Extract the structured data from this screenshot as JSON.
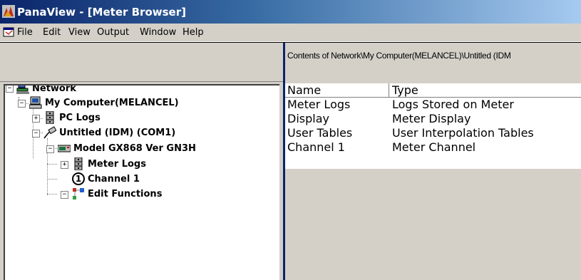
{
  "window": {
    "title": "PanaView - [Meter Browser]",
    "app_icon": "panaview-app-icon"
  },
  "menu": {
    "items": [
      "File",
      "Edit",
      "View",
      "Output",
      "Window",
      "Help"
    ]
  },
  "content_caption": "Contents of Network\\My Computer(MELANCEL)\\Untitled (IDM",
  "list": {
    "columns": [
      "Name",
      "Type"
    ],
    "rows": [
      {
        "name": "Meter Logs",
        "type": "Logs Stored on Meter"
      },
      {
        "name": "Display",
        "type": "Meter Display"
      },
      {
        "name": "User Tables",
        "type": "User Interpolation Tables"
      },
      {
        "name": "Channel 1",
        "type": "Meter Channel"
      }
    ]
  },
  "tree": {
    "network": {
      "label": "Network",
      "expander": "−",
      "icon": "network-icon"
    },
    "computer": {
      "label": "My Computer(MELANCEL)",
      "expander": "−",
      "icon": "computer-icon"
    },
    "pc_logs": {
      "label": "PC Logs",
      "expander": "+",
      "icon": "log-cabinet-icon"
    },
    "untitled": {
      "label": "Untitled (IDM) (COM1)",
      "expander": "−",
      "icon": "serial-cable-icon"
    },
    "model": {
      "label": "Model GX868 Ver GN3H",
      "expander": "−",
      "icon": "meter-device-icon"
    },
    "meter_logs": {
      "label": "Meter Logs",
      "expander": "+",
      "icon": "log-cabinet-icon"
    },
    "channel1": {
      "label": "Channel 1",
      "icon": "channel-number-icon",
      "number": "1"
    },
    "edit_functions": {
      "label": "Edit Functions",
      "expander": "−",
      "icon": "functions-icon"
    }
  },
  "colors": {
    "title_start": "#0a246a",
    "title_end": "#a6caf0",
    "face": "#d4d0c8",
    "splitter": "#0a246a"
  }
}
